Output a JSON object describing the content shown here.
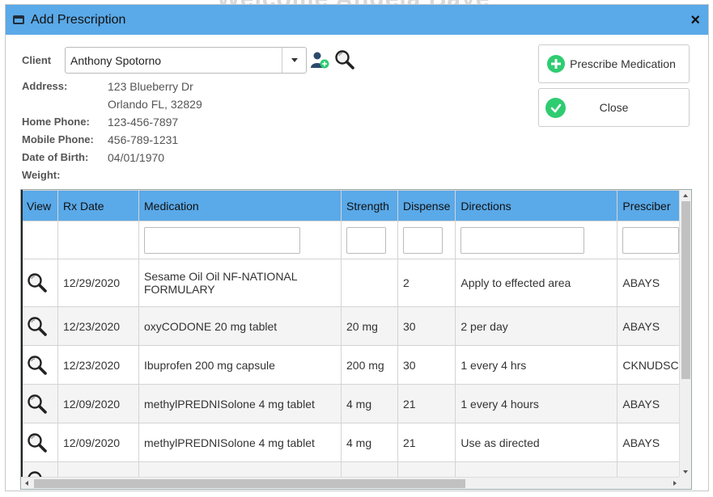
{
  "background_title": "Welcome Angela Baye",
  "dialog": {
    "title": "Add Prescription",
    "window_icon": "window-icon",
    "close_glyph": "×"
  },
  "client": {
    "label": "Client",
    "selected": "Anthony Spotorno",
    "add_icon": "add-user-icon",
    "search_icon": "search-icon"
  },
  "details": {
    "address_label": "Address:",
    "address_line1": "123 Blueberry Dr",
    "address_line2": "Orlando FL, 32829",
    "home_phone_label": "Home Phone:",
    "home_phone": "123-456-7897",
    "mobile_phone_label": "Mobile Phone:",
    "mobile_phone": "456-789-1231",
    "dob_label": "Date of Birth:",
    "dob": "04/01/1970",
    "weight_label": "Weight:",
    "weight": ""
  },
  "actions": {
    "prescribe_label": "Prescribe Medication",
    "close_label": "Close",
    "prescribe_color": "#2ecc71",
    "close_color": "#2ecc71"
  },
  "grid": {
    "header_color": "#5aa9e8",
    "columns": [
      "View",
      "Rx Date",
      "Medication",
      "Strength",
      "Dispense",
      "Directions",
      "Presciber"
    ],
    "rows": [
      {
        "rx_date": "12/29/2020",
        "medication": "Sesame Oil Oil NF-NATIONAL FORMULARY",
        "strength": "",
        "dispense": "2",
        "directions": "Apply to effected area",
        "prescriber": "ABAYS"
      },
      {
        "rx_date": "12/23/2020",
        "medication": "oxyCODONE 20 mg tablet",
        "strength": "20 mg",
        "dispense": "30",
        "directions": "2 per day",
        "prescriber": "ABAYS"
      },
      {
        "rx_date": "12/23/2020",
        "medication": "Ibuprofen 200 mg capsule",
        "strength": "200 mg",
        "dispense": "30",
        "directions": "1 every 4 hrs",
        "prescriber": "CKNUDSC"
      },
      {
        "rx_date": "12/09/2020",
        "medication": "methylPREDNISolone 4 mg tablet",
        "strength": "4 mg",
        "dispense": "21",
        "directions": "1 every 4 hours",
        "prescriber": "ABAYS"
      },
      {
        "rx_date": "12/09/2020",
        "medication": "methylPREDNISolone 4 mg tablet",
        "strength": "4 mg",
        "dispense": "21",
        "directions": "Use as directed",
        "prescriber": "ABAYS"
      }
    ]
  }
}
